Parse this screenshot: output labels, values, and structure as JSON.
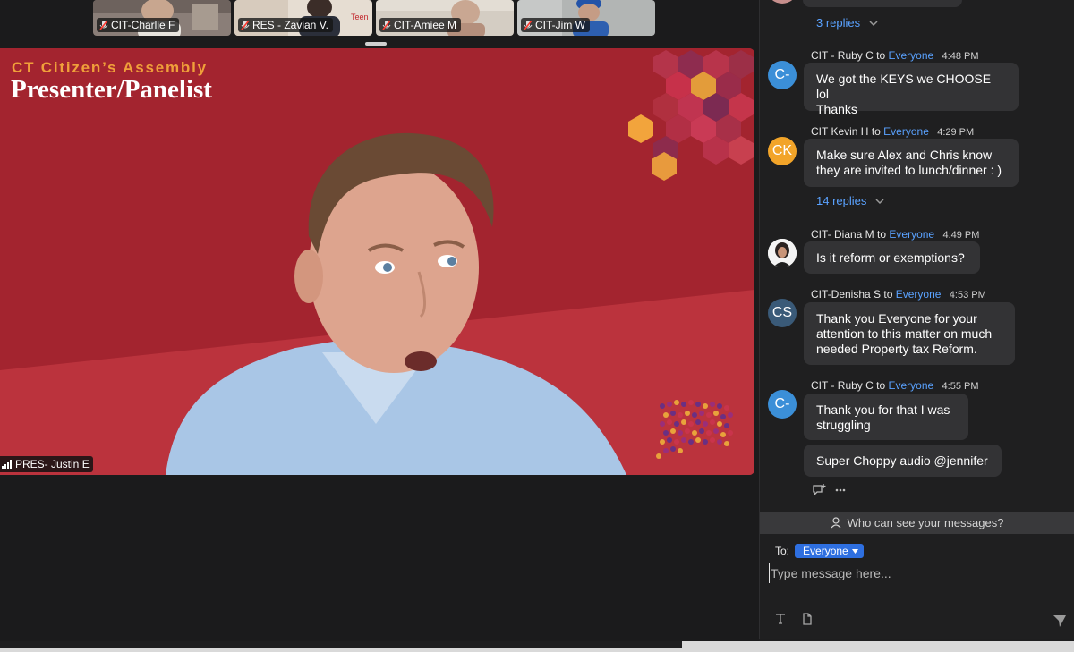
{
  "thumbnails": [
    {
      "name": "CIT-Charlie F",
      "tone": "#9d8f86"
    },
    {
      "name": "RES - Zavian V.",
      "tone": "#c9b8a6"
    },
    {
      "name": "CIT-Amiee M",
      "tone": "#cfc8bd"
    },
    {
      "name": "CIT-Jim W",
      "tone": "#b5b7b5"
    }
  ],
  "main_video": {
    "assembly_title": "CT Citizen’s Assembly",
    "role_title": "Presenter/Panelist",
    "speaker": "PRES- Justin E",
    "background_color": "#a3242f",
    "accent_color": "#f0a03a"
  },
  "chat": {
    "to_word": "to",
    "messages": [
      {
        "sender": "CIT - Ruby C",
        "recipient": "Everyone",
        "time": "4:48 PM",
        "initials": "C-",
        "avatar_color": "#3b8fd8",
        "lines": [
          "We got the KEYS we CHOOSE lol",
          "Thanks"
        ]
      },
      {
        "sender": "CIT Kevin H",
        "recipient": "Everyone",
        "time": "4:29 PM",
        "initials": "CK",
        "avatar_color": "#f2a429",
        "lines": [
          "Make sure Alex and Chris know",
          "they are invited to lunch/dinner : )"
        ]
      },
      {
        "sender": "CIT- Diana M",
        "recipient": "Everyone",
        "time": "4:49 PM",
        "initials": "",
        "avatar_color": "#ffffff",
        "lines": [
          "Is it reform or exemptions?"
        ]
      },
      {
        "sender": "CIT-Denisha S",
        "recipient": "Everyone",
        "time": "4:53 PM",
        "initials": "CS",
        "avatar_color": "#3a5a78",
        "lines": [
          "Thank you Everyone for your",
          "attention to this matter on much",
          "needed Property tax Reform."
        ]
      },
      {
        "sender": "CIT - Ruby C",
        "recipient": "Everyone",
        "time": "4:55 PM",
        "initials": "C-",
        "avatar_color": "#3b8fd8",
        "lines": [
          "Thank you for that I was",
          "struggling"
        ]
      }
    ],
    "followup": "Super Choppy audio @jennifer",
    "replies": [
      {
        "label": "3 replies"
      },
      {
        "label": "14 replies"
      }
    ],
    "privacy_notice": "Who can see your messages?",
    "compose": {
      "to_label": "To:",
      "recipient": "Everyone",
      "placeholder": "Type message here..."
    },
    "colors": {
      "link": "#5aa2ff",
      "bubble": "#333335",
      "select": "#2e6fe0"
    }
  }
}
